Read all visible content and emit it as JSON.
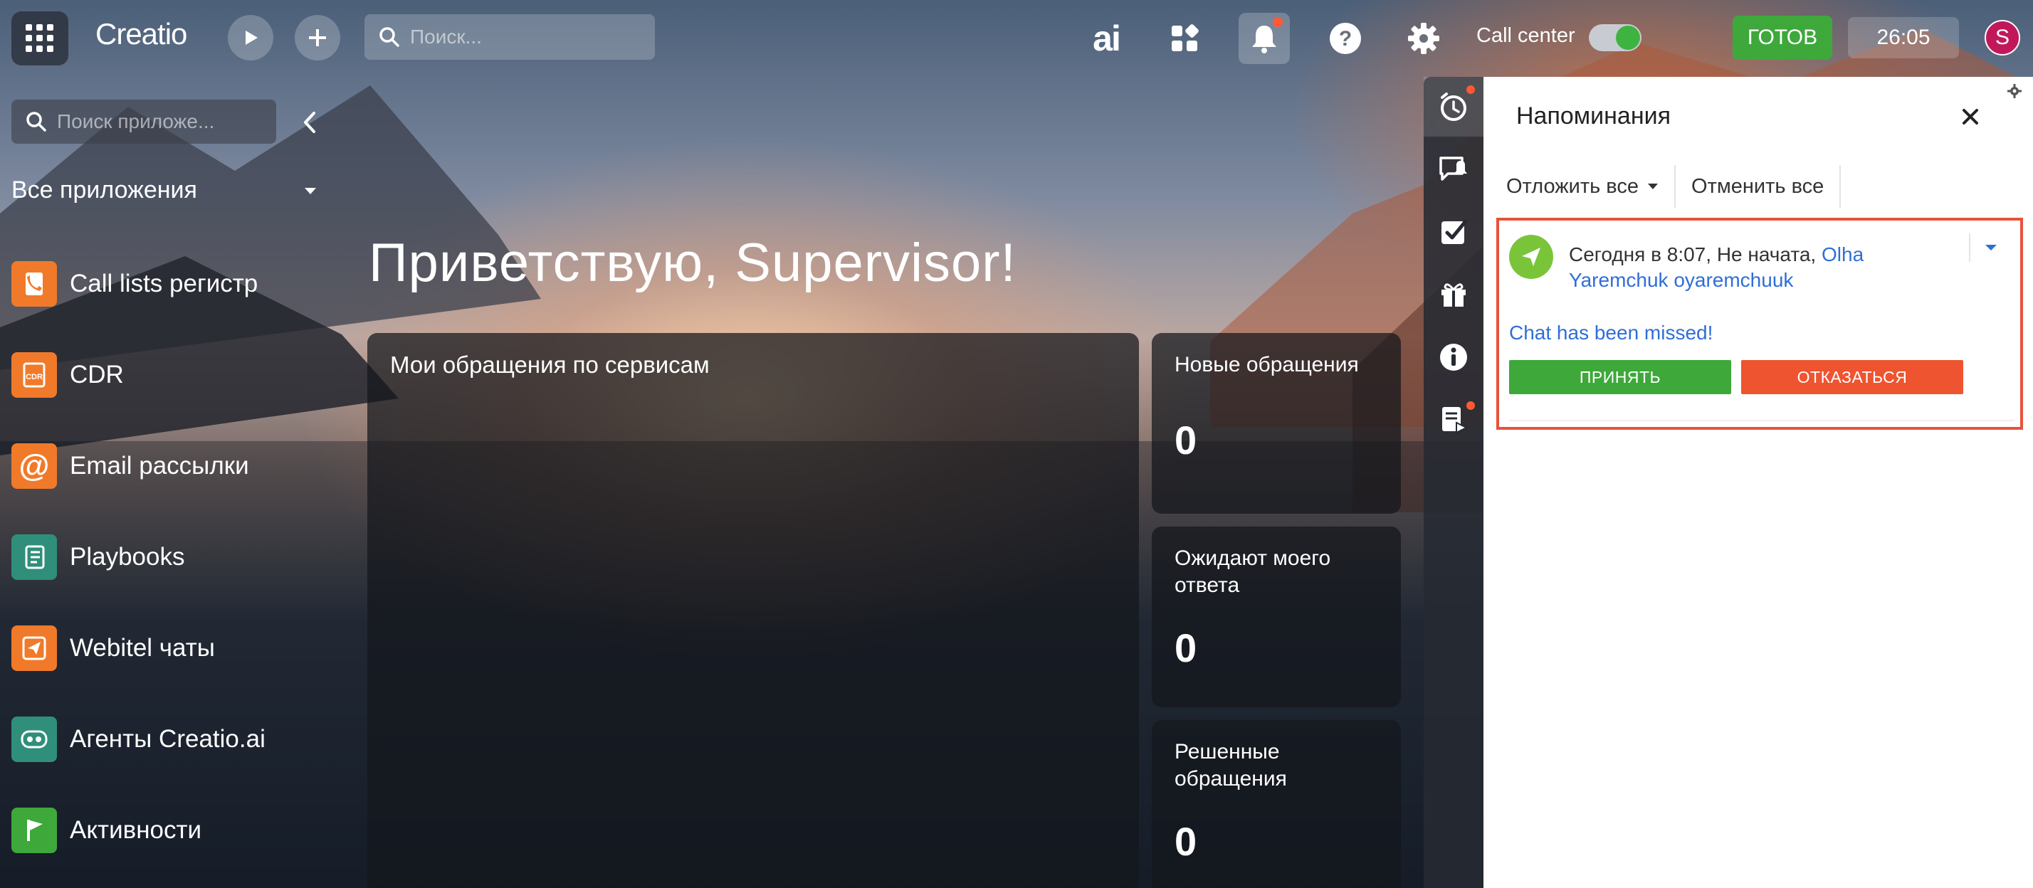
{
  "topbar": {
    "logo": "Creatio",
    "search_placeholder": "Поиск...",
    "ai_label": "ai",
    "call_center_label": "Call center",
    "status_label": "ГОТОВ",
    "timer": "26:05",
    "avatar_initial": "S"
  },
  "sidebar": {
    "search_placeholder": "Поиск приложе...",
    "section_title": "Все приложения",
    "items": [
      {
        "label": "Call lists регистр",
        "color": "#f07a2a"
      },
      {
        "label": "CDR",
        "color": "#f07a2a"
      },
      {
        "label": "Email рассылки",
        "color": "#f07a2a"
      },
      {
        "label": "Playbooks",
        "color": "#2f8f7a"
      },
      {
        "label": "Webitel чаты",
        "color": "#f07a2a"
      },
      {
        "label": "Агенты Creatio.ai",
        "color": "#2f8f7a"
      },
      {
        "label": "Активности",
        "color": "#3ea83b"
      }
    ]
  },
  "main": {
    "welcome": "Приветствую, Supervisor!",
    "services_title": "Мои обращения по сервисам",
    "metrics": [
      {
        "title": "Новые обращения",
        "value": "0"
      },
      {
        "title": "Ожидают моего ответа",
        "value": "0"
      },
      {
        "title": "Решенные обращения",
        "value": "0"
      }
    ]
  },
  "reminders": {
    "title": "Напоминания",
    "postpone_all": "Отложить все",
    "cancel_all": "Отменить все",
    "card": {
      "time": "Сегодня в 8:07,",
      "status": "Не начата,",
      "owner": "Olha Yaremchuk oyaremchuuk",
      "message": "Chat has been missed!",
      "accept": "ПРИНЯТЬ",
      "decline": "ОТКАЗАТЬСЯ"
    }
  },
  "colors": {
    "accent_green": "#3ea83b",
    "accent_red": "#ef5430",
    "link_blue": "#2f6ed8",
    "highlight_border": "#e5533a"
  }
}
